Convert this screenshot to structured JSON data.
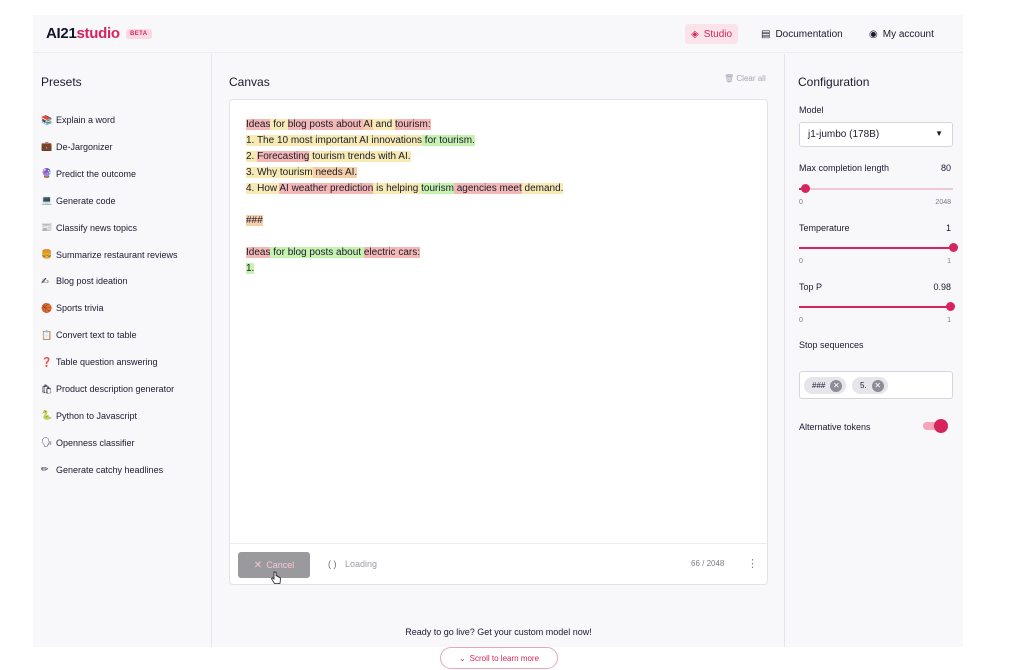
{
  "header": {
    "logo_brand": "AI21",
    "logo_product": "studio",
    "beta_badge": "BETA",
    "nav": {
      "studio": "Studio",
      "documentation": "Documentation",
      "my_account": "My account"
    }
  },
  "presets": {
    "title": "Presets",
    "items": [
      {
        "icon": "📚",
        "icon_name": "books-icon",
        "label": "Explain a word"
      },
      {
        "icon": "💼",
        "icon_name": "briefcase-icon",
        "label": "De-Jargonizer"
      },
      {
        "icon": "🔮",
        "icon_name": "crystal-ball-icon",
        "label": "Predict the outcome"
      },
      {
        "icon": "💻",
        "icon_name": "laptop-icon",
        "label": "Generate code"
      },
      {
        "icon": "📰",
        "icon_name": "newspaper-icon",
        "label": "Classify news topics"
      },
      {
        "icon": "🍔",
        "icon_name": "burger-icon",
        "label": "Summarize restaurant reviews"
      },
      {
        "icon": "✍",
        "icon_name": "writing-hand-icon",
        "label": "Blog post ideation"
      },
      {
        "icon": "🏀",
        "icon_name": "basketball-icon",
        "label": "Sports trivia"
      },
      {
        "icon": "📋",
        "icon_name": "table-icon",
        "label": "Convert text to table"
      },
      {
        "icon": "❓",
        "icon_name": "question-mark-icon",
        "label": "Table question answering"
      },
      {
        "icon": "🛍",
        "icon_name": "shopping-bags-icon",
        "label": "Product description generator"
      },
      {
        "icon": "🐍",
        "icon_name": "snake-icon",
        "label": "Python to Javascript"
      },
      {
        "icon": "🗣",
        "icon_name": "speaking-head-icon",
        "label": "Openness classifier"
      },
      {
        "icon": "✏",
        "icon_name": "pencil-icon",
        "label": "Generate catchy headlines"
      }
    ]
  },
  "canvas": {
    "title": "Canvas",
    "clear_all": "Clear all",
    "lines": [
      [
        {
          "t": "Ideas",
          "c": "r"
        },
        {
          "t": " for ",
          "c": "y"
        },
        {
          "t": "blog posts about ",
          "c": "r"
        },
        {
          "t": "AI",
          "c": "o"
        },
        {
          "t": " and ",
          "c": "y"
        },
        {
          "t": "tourism:",
          "c": "r"
        }
      ],
      [
        {
          "t": "1. The 10 most important AI innovations",
          "c": "y"
        },
        {
          "t": " for tourism.",
          "c": "g"
        }
      ],
      [
        {
          "t": "2. ",
          "c": "y"
        },
        {
          "t": "Forecasting",
          "c": "r"
        },
        {
          "t": " tourism trends with AI.",
          "c": "y"
        }
      ],
      [
        {
          "t": "3. Why tourism",
          "c": "y"
        },
        {
          "t": " needs AI.",
          "c": "o"
        }
      ],
      [
        {
          "t": "4. How ",
          "c": "y"
        },
        {
          "t": "AI weather prediction",
          "c": "r"
        },
        {
          "t": " is helping ",
          "c": "y"
        },
        {
          "t": "tourism",
          "c": "g"
        },
        {
          "t": " agencies meet",
          "c": "r"
        },
        {
          "t": " demand.",
          "c": "y"
        }
      ],
      [],
      [
        {
          "t": "###",
          "c": "o"
        }
      ],
      [],
      [
        {
          "t": "Ideas",
          "c": "r"
        },
        {
          "t": " for blog posts about ",
          "c": "g"
        },
        {
          "t": "electric cars:",
          "c": "r"
        }
      ],
      [
        {
          "t": "1.",
          "c": "g"
        }
      ]
    ],
    "cancel_label": "Cancel",
    "loading_label": "Loading",
    "loading_icon": "( )",
    "token_counter": "66 / 2048",
    "more_icon": "⋮"
  },
  "cta": {
    "text": "Ready to go live? Get your custom model now!",
    "scroll_label": "Scroll to learn more"
  },
  "config": {
    "title": "Configuration",
    "model_label": "Model",
    "model_value": "j1-jumbo (178B)",
    "max_length": {
      "label": "Max completion length",
      "value": "80",
      "min": "0",
      "max": "2048",
      "fraction": 0.039
    },
    "temperature": {
      "label": "Temperature",
      "value": "1",
      "min": "0",
      "max": "1",
      "fraction": 1.0
    },
    "top_p": {
      "label": "Top P",
      "value": "0.98",
      "min": "0",
      "max": "1",
      "fraction": 0.98
    },
    "stop_sequences": {
      "label": "Stop sequences",
      "chips": [
        "###",
        "5."
      ]
    },
    "alt_tokens": {
      "label": "Alternative tokens",
      "enabled": true
    }
  },
  "colors": {
    "accent": "#d6245c",
    "highlight_red": "#f5b9b5",
    "highlight_yellow": "#f7eab3",
    "highlight_green": "#c6f2b0",
    "highlight_orange": "#f6cfa8"
  }
}
